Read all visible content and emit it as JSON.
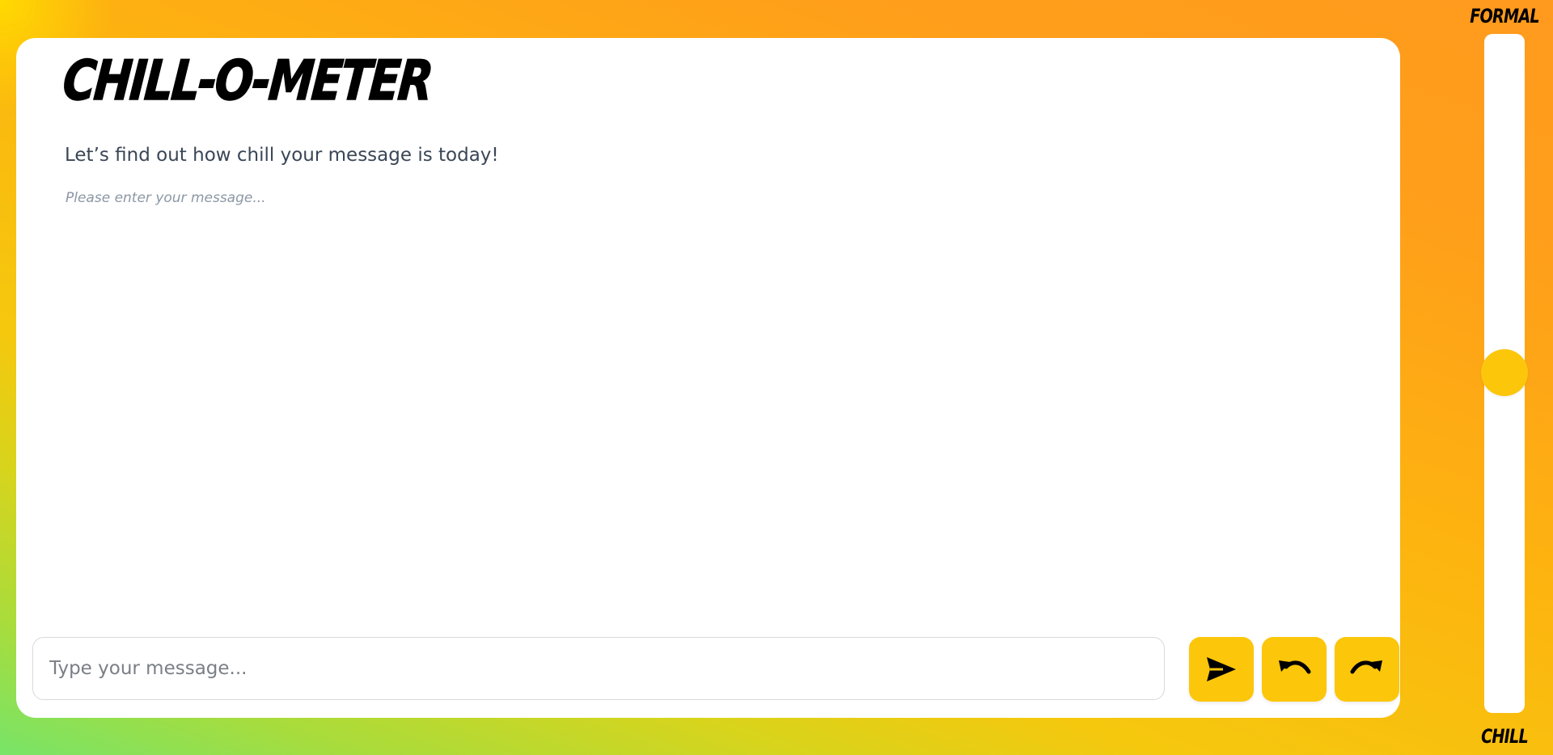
{
  "app": {
    "title": "CHILL-O-METER",
    "subtitle": "Let’s find out how chill your message is today!",
    "hint": "Please enter your message..."
  },
  "composer": {
    "placeholder": "Type your message...",
    "value": ""
  },
  "buttons": {
    "send_icon": "send-icon",
    "undo_icon": "undo-icon",
    "redo_icon": "redo-icon"
  },
  "slider": {
    "top_label": "FORMAL",
    "bottom_label": "CHILL",
    "value_fraction_from_top": 0.5
  },
  "colors": {
    "accent": "#fcc60a",
    "card": "#ffffff",
    "subtitle": "#3a4656",
    "hint": "#8c97a5"
  }
}
